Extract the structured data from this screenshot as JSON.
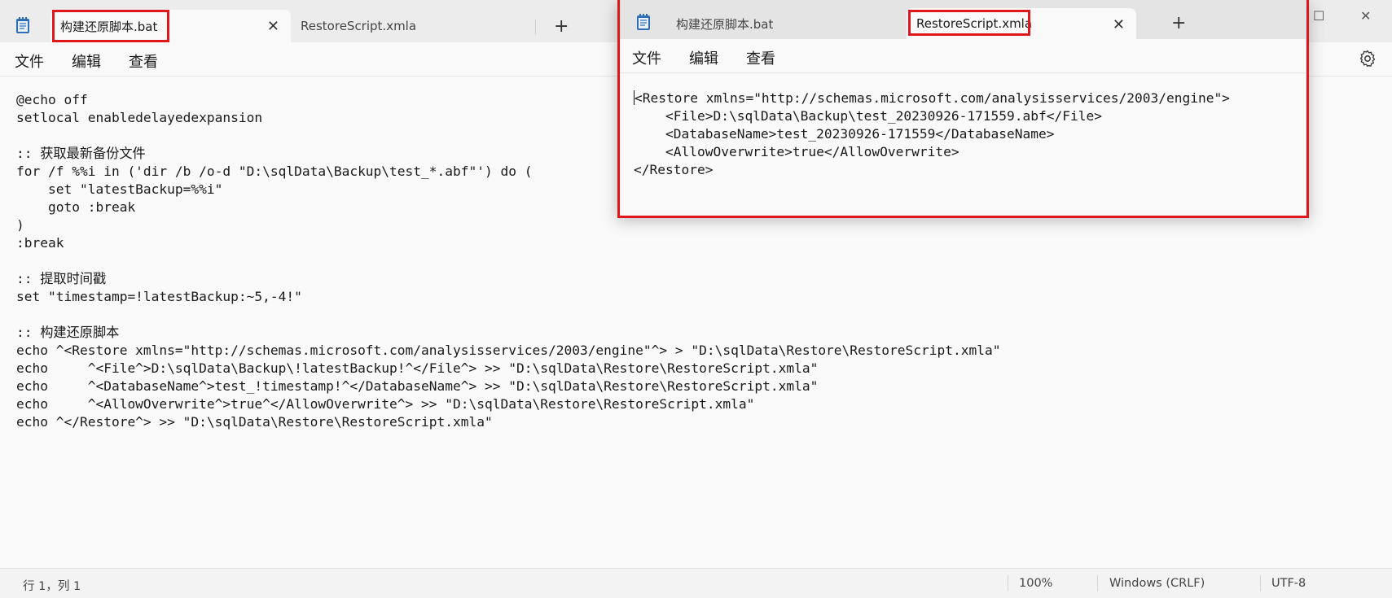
{
  "back_window": {
    "tabs": [
      {
        "label": "构建还原脚本.bat",
        "active": true
      },
      {
        "label": "RestoreScript.xmla",
        "active": false
      }
    ],
    "tab_close_glyph": "✕",
    "new_tab_glyph": "+",
    "maximize_glyph": "☐",
    "close_glyph": "✕",
    "menu": [
      "文件",
      "编辑",
      "查看"
    ],
    "editor_content": "@echo off\nsetlocal enabledelayedexpansion\n\n:: 获取最新备份文件\nfor /f %%i in ('dir /b /o-d \"D:\\sqlData\\Backup\\test_*.abf\"') do (\n    set \"latestBackup=%%i\"\n    goto :break\n)\n:break\n\n:: 提取时间戳\nset \"timestamp=!latestBackup:~5,-4!\"\n\n:: 构建还原脚本\necho ^<Restore xmlns=\"http://schemas.microsoft.com/analysisservices/2003/engine\"^> > \"D:\\sqlData\\Restore\\RestoreScript.xmla\"\necho     ^<File^>D:\\sqlData\\Backup\\!latestBackup!^</File^> >> \"D:\\sqlData\\Restore\\RestoreScript.xmla\"\necho     ^<DatabaseName^>test_!timestamp!^</DatabaseName^> >> \"D:\\sqlData\\Restore\\RestoreScript.xmla\"\necho     ^<AllowOverwrite^>true^</AllowOverwrite^> >> \"D:\\sqlData\\Restore\\RestoreScript.xmla\"\necho ^</Restore^> >> \"D:\\sqlData\\Restore\\RestoreScript.xmla\"",
    "status": {
      "position": "行 1，列 1",
      "zoom": "100%",
      "line_ending": "Windows (CRLF)",
      "encoding": "UTF-8"
    }
  },
  "front_window": {
    "tabs": [
      {
        "label": "构建还原脚本.bat",
        "active": false
      },
      {
        "label": "RestoreScript.xmla",
        "active": true
      }
    ],
    "tab_close_glyph": "✕",
    "new_tab_glyph": "+",
    "menu": [
      "文件",
      "编辑",
      "查看"
    ],
    "editor_content": "Restore xmlns=\"http://schemas.microsoft.com/analysisservices/2003/engine\">\n    <File>D:\\sqlData\\Backup\\test_20230926-171559.abf</File>\n    <DatabaseName>test_20230926-171559</DatabaseName>\n    <AllowOverwrite>true</AllowOverwrite>\n</Restore>",
    "editor_first_char": "<"
  },
  "colors": {
    "highlight_red": "#e0161c",
    "tabbar": "#ececec",
    "editor_bg": "#f9f9f9"
  }
}
